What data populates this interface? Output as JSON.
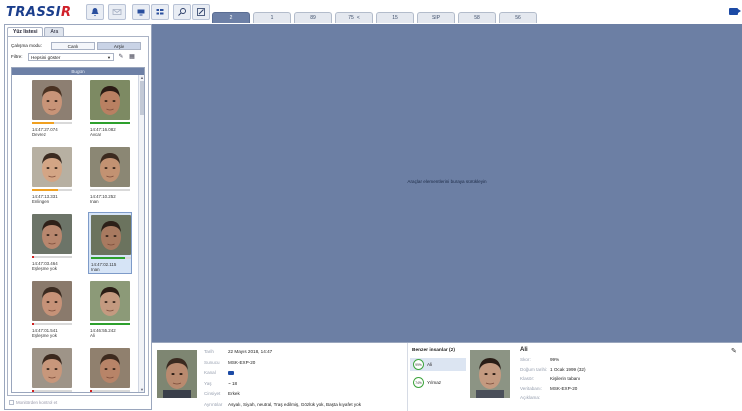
{
  "app": {
    "logo_main": "TRASSI",
    "logo_accent": "R"
  },
  "toolbar": {
    "buttons": [
      "bell-icon",
      "mail-icon",
      "screen-icon",
      "layout-icon",
      "search-icon",
      "edit-icon"
    ],
    "tabs": [
      {
        "label": "2",
        "active": true,
        "link": false
      },
      {
        "label": "1",
        "active": false,
        "link": false
      },
      {
        "label": "89",
        "active": false,
        "link": false
      },
      {
        "label": "75",
        "active": false,
        "link": true
      },
      {
        "label": "15",
        "active": false,
        "link": false
      },
      {
        "label": "SIP",
        "active": false,
        "link": false
      },
      {
        "label": "58",
        "active": false,
        "link": false
      },
      {
        "label": "56",
        "active": false,
        "link": false
      }
    ],
    "link_glyph": "<"
  },
  "left_panel": {
    "tabs": [
      {
        "label": "Yüz listesi",
        "active": true
      },
      {
        "label": "Ara",
        "active": false
      }
    ],
    "mode_label": "Çalışma modu:",
    "mode_live": "Canlı",
    "mode_archive": "Arşiv",
    "filter_label": "Filtre:",
    "filter_value": "Hepsini göster",
    "list_header": "Bugün",
    "footer_checkbox": "Monitörden kontrol et",
    "cards": [
      {
        "time": "14:47:27.074",
        "name": "Devrez",
        "bar_color": "#f0a020",
        "bar_fill": 0.55,
        "selected": false,
        "skin": "#c89478",
        "hair": "#4a3222",
        "bg": "#8d7f72"
      },
      {
        "time": "14:47:16.082",
        "name": "Avcar",
        "bar_color": "#2da02d",
        "bar_fill": 1.0,
        "selected": false,
        "skin": "#b98062",
        "hair": "#2a1b14",
        "bg": "#7d8a63"
      },
      {
        "time": "14:47:13.331",
        "name": "Enlingen",
        "bar_color": "#f0a020",
        "bar_fill": 0.65,
        "selected": false,
        "skin": "#d3a585",
        "hair": "#3a2a20",
        "bg": "#b7b0a2"
      },
      {
        "time": "14:47:10.252",
        "name": "Inan",
        "bar_color": "#c8c8c8",
        "bar_fill": 0.0,
        "selected": false,
        "skin": "#c29272",
        "hair": "#3b2a1e",
        "bg": "#8b8774"
      },
      {
        "time": "14:47:03.464",
        "name": "Eşleşme yok",
        "bar_color": "#d02020",
        "bar_fill": 0.06,
        "selected": false,
        "skin": "#b8876e",
        "hair": "#2e2018",
        "bg": "#6c7468"
      },
      {
        "time": "14:47:02.115",
        "name": "Inan",
        "bar_color": "#2da02d",
        "bar_fill": 0.85,
        "selected": true,
        "skin": "#a87a60",
        "hair": "#2c2018",
        "bg": "#6b735e"
      },
      {
        "time": "14:47:01.541",
        "name": "Eşleşme yok",
        "bar_color": "#d02020",
        "bar_fill": 0.06,
        "selected": false,
        "skin": "#c69278",
        "hair": "#3a2a20",
        "bg": "#8a7a6c"
      },
      {
        "time": "14:46:55.242",
        "name": "Ali",
        "bar_color": "#2da02d",
        "bar_fill": 1.0,
        "selected": false,
        "skin": "#c49a80",
        "hair": "#2a1d16",
        "bg": "#8c9a78"
      },
      {
        "time": "",
        "name": "",
        "bar_color": "#d02020",
        "bar_fill": 0.06,
        "selected": false,
        "skin": "#c8977b",
        "hair": "#3a281d",
        "bg": "#9e9488"
      },
      {
        "time": "",
        "name": "",
        "bar_color": "#d02020",
        "bar_fill": 0.06,
        "selected": false,
        "skin": "#b88468",
        "hair": "#3d2a1e",
        "bg": "#90806e"
      }
    ]
  },
  "main_view": {
    "hint": "Araçlar elementlerini buraya sürükleyin"
  },
  "details": {
    "rows": [
      {
        "label": "Tarih",
        "value": "22 Mayıs 2018, 14:47",
        "camera_icon": false
      },
      {
        "label": "Sunucu",
        "value": "MSK-EXP-20",
        "camera_icon": false
      },
      {
        "label": "Kanal",
        "value": "",
        "camera_icon": true
      },
      {
        "label": "Yaş",
        "value": "~ 18",
        "camera_icon": false
      },
      {
        "label": "Cinsiyet",
        "value": "Erkek",
        "camera_icon": false
      },
      {
        "label": "Ayrıntılar",
        "value": "Asyalı, Siyah, neutral, Traş edilmiş, Gözlük yok, Başta kıyafet yok",
        "camera_icon": false
      }
    ]
  },
  "similar": {
    "title": "Benzer insanlar (2)",
    "items": [
      {
        "percent": "99%",
        "name": "Ali",
        "selected": true
      },
      {
        "percent": "74%",
        "name": "Yılmaz",
        "selected": false
      }
    ]
  },
  "person": {
    "name": "Ali",
    "rows": [
      {
        "label": "Skor:",
        "value": "99%"
      },
      {
        "label": "Doğum tarihi:",
        "value": "1 Ocak 1999 (32)"
      },
      {
        "label": "Klasör:",
        "value": "Kişilerin tabanı"
      },
      {
        "label": "Veritabanı:",
        "value": "MSK-EXP-20"
      },
      {
        "label": "Açıklama:",
        "value": ""
      }
    ]
  },
  "colors": {
    "accent": "#6d80a6",
    "main_bg": "#6c7fa4",
    "logo_blue": "#1b3e8c",
    "logo_red": "#d0202a"
  }
}
